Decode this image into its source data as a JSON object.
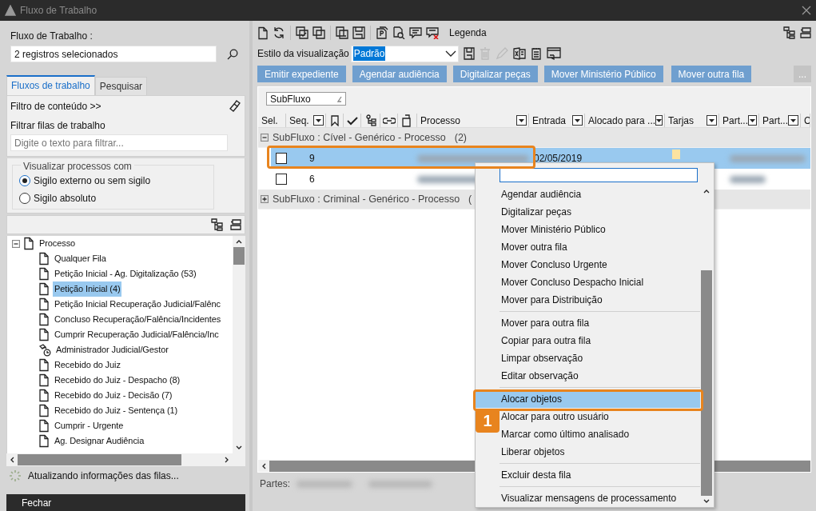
{
  "window": {
    "title": "Fluxo de Trabalho"
  },
  "left_panel": {
    "workflow_label": "Fluxo de Trabalho :",
    "workflow_value": "2 registros selecionados",
    "tabs": [
      {
        "label": "Fluxos de trabalho",
        "selected": true
      },
      {
        "label": "Pesquisar",
        "selected": false
      }
    ],
    "content_filter": "Filtro de conteúdo >>",
    "filter_label": "Filtrar filas de trabalho",
    "filter_placeholder": "Digite o texto para filtrar...",
    "visibility_group": {
      "title": "Visualizar processos com",
      "options": [
        {
          "label": "Sigilo externo ou sem sigilo",
          "selected": true
        },
        {
          "label": "Sigilo absoluto",
          "selected": false
        }
      ]
    },
    "tree": [
      {
        "label": "Processo",
        "kind": "queue",
        "expanded": true,
        "selected": false,
        "children": [
          {
            "label": "Qualquer Fila",
            "kind": "queue",
            "selected": false
          },
          {
            "label": "Petição Inicial - Ag. Digitalização (53)",
            "kind": "queue",
            "selected": false
          },
          {
            "label": "Petição Inicial (4)",
            "kind": "queue",
            "selected": true
          },
          {
            "label": "Petição Inicial Recuperação Judicial/Falênc",
            "kind": "queue",
            "selected": false
          },
          {
            "label": "Concluso Recuperação/Falência/Incidentes",
            "kind": "queue",
            "selected": false
          },
          {
            "label": "Cumprir Recuperação Judicial/Falência/Inc",
            "kind": "queue",
            "selected": false
          },
          {
            "label": "Administrador Judicial/Gestor",
            "kind": "timed",
            "selected": false
          },
          {
            "label": "Recebido do Juiz",
            "kind": "queue",
            "selected": false
          },
          {
            "label": "Recebido do Juiz - Despacho (8)",
            "kind": "queue",
            "selected": false
          },
          {
            "label": "Recebido do Juiz - Decisão (7)",
            "kind": "queue",
            "selected": false
          },
          {
            "label": "Recebido do Juiz - Sentença (1)",
            "kind": "queue",
            "selected": false
          },
          {
            "label": "Cumprir - Urgente",
            "kind": "queue",
            "selected": false
          },
          {
            "label": "Ag. Designar Audiência",
            "kind": "queue",
            "selected": false
          }
        ]
      }
    ],
    "status": "Atualizando informações das filas...",
    "close_button": "Fechar"
  },
  "toolbar": {
    "legend": "Legenda"
  },
  "view_style": {
    "label": "Estilo da visualização",
    "value": "Padrão"
  },
  "action_buttons": [
    "Emitir expediente",
    "Agendar audiência",
    "Digitalizar peças",
    "Mover Ministério Público",
    "Mover outra fila"
  ],
  "more_button": "...",
  "grid": {
    "group_by": "SubFluxo",
    "columns": [
      {
        "kind": "text",
        "label": "Sel.",
        "filter": false
      },
      {
        "kind": "text",
        "label": "Seq.",
        "filter": true
      },
      {
        "kind": "icon"
      },
      {
        "kind": "icon"
      },
      {
        "kind": "icon"
      },
      {
        "kind": "icon"
      },
      {
        "kind": "icon"
      },
      {
        "kind": "text",
        "label": "Processo",
        "filter": true
      },
      {
        "kind": "text",
        "label": "Entrada",
        "filter": true
      },
      {
        "kind": "text",
        "label": "Alocado para ...",
        "filter": true
      },
      {
        "kind": "text",
        "label": "Tarjas",
        "filter": true
      },
      {
        "kind": "text",
        "label": "Part...",
        "filter": true
      },
      {
        "kind": "text",
        "label": "Part...",
        "filter": true
      },
      {
        "kind": "text",
        "label": "C",
        "filter": false
      }
    ],
    "groups": [
      {
        "title": "SubFluxo : Cível - Genérico - Processo",
        "count": "(2)",
        "expanded": true,
        "rows": [
          {
            "seq": "9",
            "entry": "02/05/2019",
            "selected": true,
            "checked": false,
            "color": "#fde3a0"
          },
          {
            "seq": "6",
            "selected": false,
            "checked": false
          }
        ]
      },
      {
        "title": "SubFluxo : Criminal - Genérico - Processo",
        "count": "(",
        "expanded": false
      }
    ]
  },
  "parts_label": "Partes:",
  "context_menu": {
    "groups": [
      [
        {
          "label": "Agendar audiência",
          "selected": false
        },
        {
          "label": "Digitalizar peças",
          "selected": false
        },
        {
          "label": "Mover Ministério Público",
          "selected": false
        },
        {
          "label": "Mover outra fila",
          "selected": false
        },
        {
          "label": "Mover Concluso Urgente",
          "selected": false
        },
        {
          "label": "Mover Concluso Despacho Inicial",
          "selected": false
        },
        {
          "label": "Mover para Distribuição",
          "selected": false
        }
      ],
      [
        {
          "label": "Mover para outra fila",
          "selected": false
        },
        {
          "label": "Copiar para outra fila",
          "selected": false
        },
        {
          "label": "Limpar observação",
          "selected": false
        },
        {
          "label": "Editar observação",
          "selected": false
        }
      ],
      [
        {
          "label": "Alocar objetos",
          "selected": true
        },
        {
          "label": "Alocar para outro usuário",
          "selected": false
        },
        {
          "label": "Marcar como último analisado",
          "selected": false
        },
        {
          "label": "Liberar objetos",
          "selected": false
        }
      ],
      [
        {
          "label": "Excluir desta fila",
          "selected": false
        }
      ],
      [
        {
          "label": "Visualizar mensagens de processamento",
          "selected": false
        }
      ]
    ]
  },
  "callout": {
    "number": "1"
  }
}
